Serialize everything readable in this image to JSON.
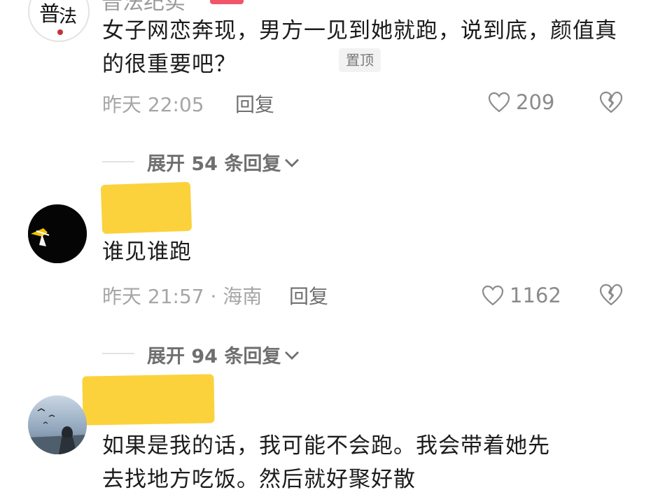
{
  "comment1": {
    "username": "普法纪实",
    "avatar_icon": "pufa-logo-icon",
    "text": "女子网恋奔现，男方一见到她就跑，说到底，颜值真的很重要吧？",
    "pinned_label": "置顶",
    "time": "昨天 22:05",
    "reply_label": "回复",
    "likes": "209",
    "expand_replies": "展开 54 条回复"
  },
  "comment2": {
    "username_hidden": true,
    "avatar_icon": "black-avatar-icon",
    "text": "谁见谁跑",
    "time_location": "昨天 21:57 · 海南",
    "reply_label": "回复",
    "likes": "1162",
    "expand_replies": "展开 94 条回复"
  },
  "comment3": {
    "username_hidden": true,
    "avatar_icon": "landscape-avatar-icon",
    "text_line1": "如果是我的话，我可能不会跑。我会带着她先",
    "text_line2": "去找地方吃饭。然后就好聚好散"
  },
  "colors": {
    "highlight": "#fbd23c",
    "badge": "#f0556a",
    "meta_text": "#a6a6a6"
  }
}
